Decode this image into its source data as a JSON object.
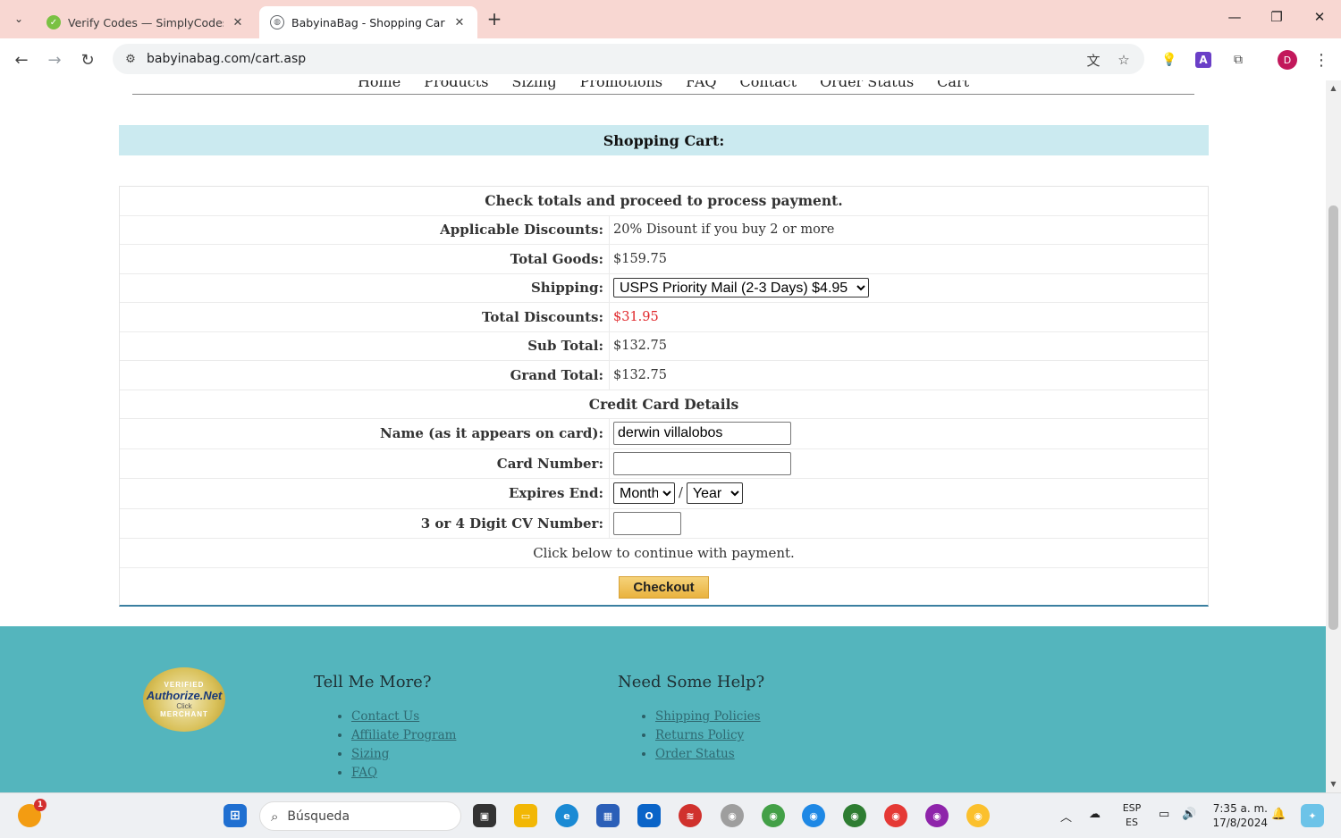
{
  "browser": {
    "tabs": [
      {
        "title": "Verify Codes — SimplyCodes",
        "active": false
      },
      {
        "title": "BabyinaBag - Shopping Cart",
        "active": true
      }
    ],
    "url": "babyinabag.com/cart.asp",
    "profile_initial": "D",
    "extension_letter": "A"
  },
  "site_nav": [
    "Home",
    "Products",
    "Sizing",
    "Promotions",
    "FAQ",
    "Contact",
    "Order Status",
    "Cart"
  ],
  "cart": {
    "header": "Shopping Cart:",
    "instructions": "Check totals and proceed to process payment.",
    "rows": {
      "discounts_label": "Applicable Discounts:",
      "discounts_value": "20% Disount if you buy 2 or more",
      "goods_label": "Total Goods:",
      "goods_value": "$159.75",
      "shipping_label": "Shipping:",
      "shipping_value": "USPS Priority Mail (2-3 Days) $4.95",
      "total_discounts_label": "Total Discounts:",
      "total_discounts_value": "$31.95",
      "subtotal_label": "Sub Total:",
      "subtotal_value": "$132.75",
      "grand_label": "Grand Total:",
      "grand_value": "$132.75"
    },
    "cc": {
      "heading": "Credit Card Details",
      "name_label": "Name (as it appears on card):",
      "name_value": "derwin villalobos",
      "card_label": "Card Number:",
      "card_value": "",
      "expires_label": "Expires End:",
      "month_value": "Month",
      "separator": "/",
      "year_value": "Year",
      "cv_label": "3 or 4 Digit CV Number:",
      "cv_value": ""
    },
    "continue_text": "Click below to continue with payment.",
    "checkout_label": "Checkout",
    "discount_color": "#e0262a"
  },
  "footer": {
    "seal": {
      "top": "VERIFIED",
      "brand": "Authorize.Net",
      "mid": "Click",
      "bottom": "MERCHANT"
    },
    "col1": {
      "title": "Tell Me More?",
      "links": [
        "Contact Us",
        "Affiliate Program",
        "Sizing",
        "FAQ"
      ]
    },
    "col2": {
      "title": "Need Some Help?",
      "links": [
        "Shipping Policies",
        "Returns Policy",
        "Order Status"
      ]
    }
  },
  "taskbar": {
    "search_placeholder": "Búsqueda",
    "lang_top": "ESP",
    "lang_bottom": "ES",
    "time": "7:35 a. m.",
    "date": "17/8/2024",
    "notification_badge": "1"
  }
}
